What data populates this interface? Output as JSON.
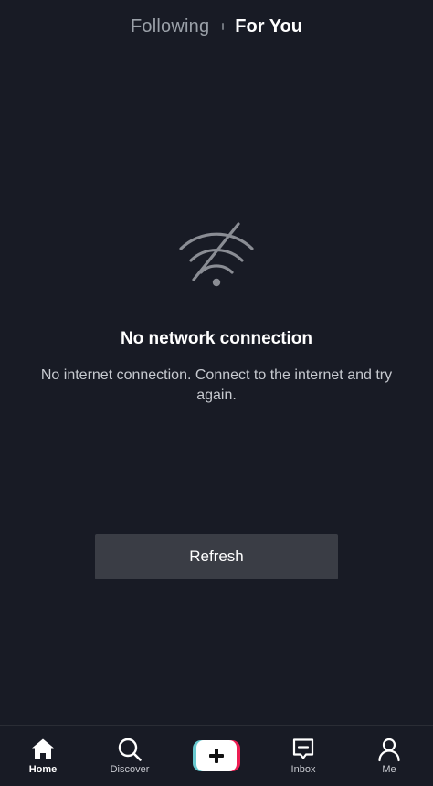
{
  "header": {
    "tabs": [
      {
        "label": "Following",
        "active": false
      },
      {
        "label": "For You",
        "active": true
      }
    ]
  },
  "main": {
    "icon": "wifi-off-icon",
    "title": "No network connection",
    "description": "No internet connection. Connect to the internet and try again.",
    "refresh_label": "Refresh"
  },
  "nav": {
    "items": [
      {
        "label": "Home",
        "icon": "home-icon",
        "active": true
      },
      {
        "label": "Discover",
        "icon": "search-icon",
        "active": false
      },
      {
        "label": "",
        "icon": "plus-icon",
        "active": false
      },
      {
        "label": "Inbox",
        "icon": "message-icon",
        "active": false
      },
      {
        "label": "Me",
        "icon": "profile-icon",
        "active": false
      }
    ]
  },
  "colors": {
    "background": "#181b25",
    "button": "#3a3d45",
    "accent_cyan": "#69c9d0",
    "accent_red": "#ee1d52"
  }
}
